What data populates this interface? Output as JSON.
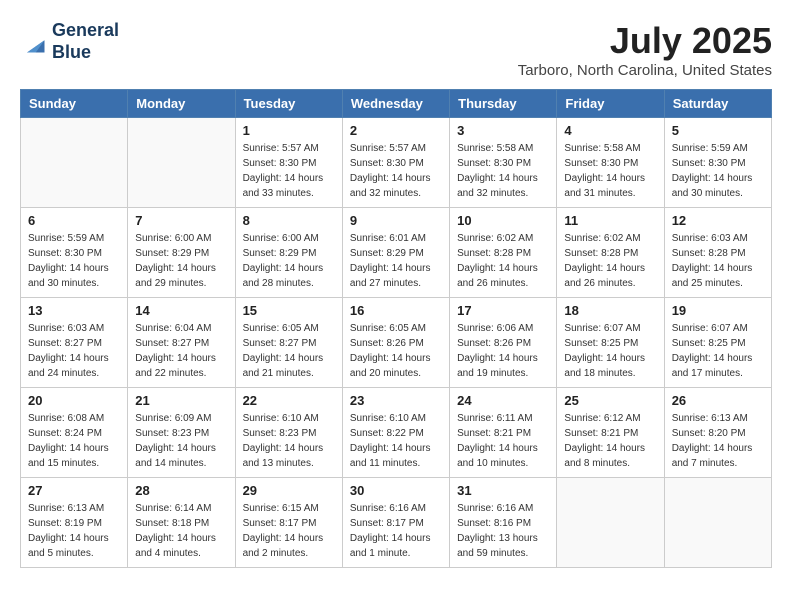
{
  "logo": {
    "line1": "General",
    "line2": "Blue"
  },
  "title": "July 2025",
  "location": "Tarboro, North Carolina, United States",
  "days_of_week": [
    "Sunday",
    "Monday",
    "Tuesday",
    "Wednesday",
    "Thursday",
    "Friday",
    "Saturday"
  ],
  "weeks": [
    [
      {
        "day": "",
        "info": ""
      },
      {
        "day": "",
        "info": ""
      },
      {
        "day": "1",
        "sunrise": "5:57 AM",
        "sunset": "8:30 PM",
        "daylight": "14 hours and 33 minutes."
      },
      {
        "day": "2",
        "sunrise": "5:57 AM",
        "sunset": "8:30 PM",
        "daylight": "14 hours and 32 minutes."
      },
      {
        "day": "3",
        "sunrise": "5:58 AM",
        "sunset": "8:30 PM",
        "daylight": "14 hours and 32 minutes."
      },
      {
        "day": "4",
        "sunrise": "5:58 AM",
        "sunset": "8:30 PM",
        "daylight": "14 hours and 31 minutes."
      },
      {
        "day": "5",
        "sunrise": "5:59 AM",
        "sunset": "8:30 PM",
        "daylight": "14 hours and 30 minutes."
      }
    ],
    [
      {
        "day": "6",
        "sunrise": "5:59 AM",
        "sunset": "8:30 PM",
        "daylight": "14 hours and 30 minutes."
      },
      {
        "day": "7",
        "sunrise": "6:00 AM",
        "sunset": "8:29 PM",
        "daylight": "14 hours and 29 minutes."
      },
      {
        "day": "8",
        "sunrise": "6:00 AM",
        "sunset": "8:29 PM",
        "daylight": "14 hours and 28 minutes."
      },
      {
        "day": "9",
        "sunrise": "6:01 AM",
        "sunset": "8:29 PM",
        "daylight": "14 hours and 27 minutes."
      },
      {
        "day": "10",
        "sunrise": "6:02 AM",
        "sunset": "8:28 PM",
        "daylight": "14 hours and 26 minutes."
      },
      {
        "day": "11",
        "sunrise": "6:02 AM",
        "sunset": "8:28 PM",
        "daylight": "14 hours and 26 minutes."
      },
      {
        "day": "12",
        "sunrise": "6:03 AM",
        "sunset": "8:28 PM",
        "daylight": "14 hours and 25 minutes."
      }
    ],
    [
      {
        "day": "13",
        "sunrise": "6:03 AM",
        "sunset": "8:27 PM",
        "daylight": "14 hours and 24 minutes."
      },
      {
        "day": "14",
        "sunrise": "6:04 AM",
        "sunset": "8:27 PM",
        "daylight": "14 hours and 22 minutes."
      },
      {
        "day": "15",
        "sunrise": "6:05 AM",
        "sunset": "8:27 PM",
        "daylight": "14 hours and 21 minutes."
      },
      {
        "day": "16",
        "sunrise": "6:05 AM",
        "sunset": "8:26 PM",
        "daylight": "14 hours and 20 minutes."
      },
      {
        "day": "17",
        "sunrise": "6:06 AM",
        "sunset": "8:26 PM",
        "daylight": "14 hours and 19 minutes."
      },
      {
        "day": "18",
        "sunrise": "6:07 AM",
        "sunset": "8:25 PM",
        "daylight": "14 hours and 18 minutes."
      },
      {
        "day": "19",
        "sunrise": "6:07 AM",
        "sunset": "8:25 PM",
        "daylight": "14 hours and 17 minutes."
      }
    ],
    [
      {
        "day": "20",
        "sunrise": "6:08 AM",
        "sunset": "8:24 PM",
        "daylight": "14 hours and 15 minutes."
      },
      {
        "day": "21",
        "sunrise": "6:09 AM",
        "sunset": "8:23 PM",
        "daylight": "14 hours and 14 minutes."
      },
      {
        "day": "22",
        "sunrise": "6:10 AM",
        "sunset": "8:23 PM",
        "daylight": "14 hours and 13 minutes."
      },
      {
        "day": "23",
        "sunrise": "6:10 AM",
        "sunset": "8:22 PM",
        "daylight": "14 hours and 11 minutes."
      },
      {
        "day": "24",
        "sunrise": "6:11 AM",
        "sunset": "8:21 PM",
        "daylight": "14 hours and 10 minutes."
      },
      {
        "day": "25",
        "sunrise": "6:12 AM",
        "sunset": "8:21 PM",
        "daylight": "14 hours and 8 minutes."
      },
      {
        "day": "26",
        "sunrise": "6:13 AM",
        "sunset": "8:20 PM",
        "daylight": "14 hours and 7 minutes."
      }
    ],
    [
      {
        "day": "27",
        "sunrise": "6:13 AM",
        "sunset": "8:19 PM",
        "daylight": "14 hours and 5 minutes."
      },
      {
        "day": "28",
        "sunrise": "6:14 AM",
        "sunset": "8:18 PM",
        "daylight": "14 hours and 4 minutes."
      },
      {
        "day": "29",
        "sunrise": "6:15 AM",
        "sunset": "8:17 PM",
        "daylight": "14 hours and 2 minutes."
      },
      {
        "day": "30",
        "sunrise": "6:16 AM",
        "sunset": "8:17 PM",
        "daylight": "14 hours and 1 minute."
      },
      {
        "day": "31",
        "sunrise": "6:16 AM",
        "sunset": "8:16 PM",
        "daylight": "13 hours and 59 minutes."
      },
      {
        "day": "",
        "info": ""
      },
      {
        "day": "",
        "info": ""
      }
    ]
  ]
}
